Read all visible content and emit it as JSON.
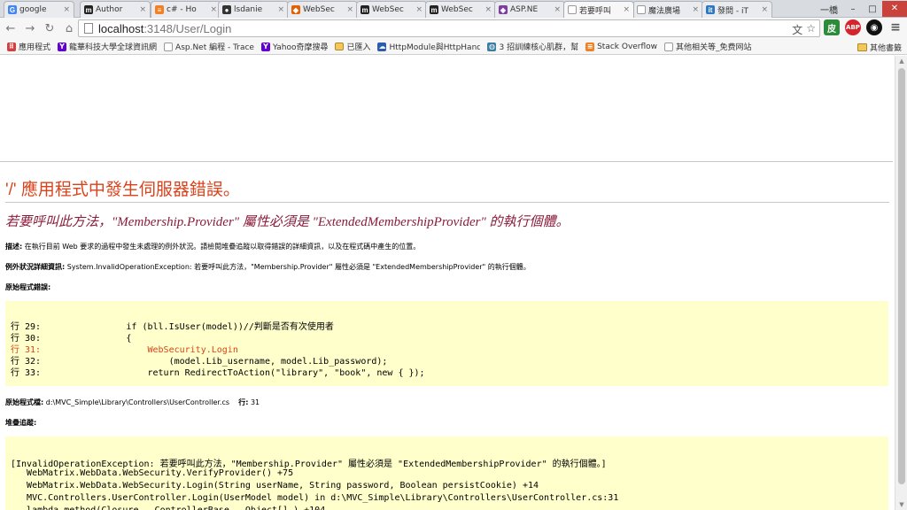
{
  "tabs": [
    {
      "title": "google",
      "icon": "google-icon",
      "color": "#4285f4",
      "glyph": "G"
    },
    {
      "title": "Author",
      "icon": "moodle-icon",
      "color": "#222222",
      "glyph": "m"
    },
    {
      "title": "c# - Ho",
      "icon": "stackoverflow-icon",
      "color": "#f48024",
      "glyph": "≡"
    },
    {
      "title": "lsdanie",
      "icon": "github-icon",
      "color": "#333333",
      "glyph": "●"
    },
    {
      "title": "WebSec",
      "icon": "webfox-icon",
      "color": "#e66000",
      "glyph": "◆"
    },
    {
      "title": "WebSec",
      "icon": "moodle-icon",
      "color": "#222222",
      "glyph": "m"
    },
    {
      "title": "WebSec",
      "icon": "moodle-icon",
      "color": "#222222",
      "glyph": "m"
    },
    {
      "title": "ASP.NE",
      "icon": "aspnet-icon",
      "color": "#7a3ea1",
      "glyph": "◈"
    },
    {
      "title": "若要呼叫",
      "icon": "page-icon",
      "color": "#ffffff",
      "glyph": "",
      "active": true
    },
    {
      "title": "魔法廣場",
      "icon": "page-icon",
      "color": "#ffffff",
      "glyph": ""
    },
    {
      "title": "發問 - iT",
      "icon": "ithome-icon",
      "color": "#2b78c5",
      "glyph": "it"
    }
  ],
  "window": {
    "user": "一橋"
  },
  "toolbar": {
    "url_host": "localhost",
    "url_path": ":3148/User/Login"
  },
  "bookmarks": {
    "items": [
      {
        "label": "應用程式",
        "icon": "apps-grid-icon",
        "color": "#d04040",
        "glyph": "⠿"
      },
      {
        "label": "龍華科技大學全球資訊網",
        "icon": "yahoo-icon",
        "color": "#5f01d1",
        "glyph": "Y"
      },
      {
        "label": "Asp.Net 編程 - Trace",
        "icon": "page-icon",
        "color": "#ffffff",
        "glyph": ""
      },
      {
        "label": "Yahoo奇摩搜尋",
        "icon": "yahoo-icon",
        "color": "#5f01d1",
        "glyph": "Y"
      },
      {
        "label": "已匯入",
        "icon": "folder-icon",
        "color": "#ffffff",
        "glyph": ""
      },
      {
        "label": "HttpModule與HttpHandler",
        "icon": "cloud-icon",
        "color": "#2a5db0",
        "glyph": "☁"
      },
      {
        "label": "3 招訓練核心肌群，幫",
        "icon": "fitness-icon",
        "color": "#3b7ea1",
        "glyph": "◍"
      },
      {
        "label": "Stack Overflow",
        "icon": "stackoverflow-icon",
        "color": "#f48024",
        "glyph": "≡"
      },
      {
        "label": "其他相关等_免费网站",
        "icon": "page-icon",
        "color": "#ffffff",
        "glyph": ""
      }
    ],
    "other": "其他書籤"
  },
  "error": {
    "title_slash": "'/'",
    "title_text": " 應用程式中發生伺服器錯誤。",
    "subtitle": "若要呼叫此方法，\"Membership.Provider\" 屬性必須是 \"ExtendedMembershipProvider\" 的執行個體。",
    "desc_label": "描述:",
    "desc_text": " 在執行目前 Web 要求的過程中發生未處理的例外狀況。請檢閱堆疊追蹤以取得錯誤的詳細資訊，以及在程式碼中產生的位置。",
    "exc_label": "例外狀況詳細資訊:",
    "exc_text": " System.InvalidOperationException: 若要呼叫此方法，\"Membership.Provider\" 屬性必須是 \"ExtendedMembershipProvider\" 的執行個體。",
    "src_label": "原始程式錯誤:",
    "source_lines": [
      {
        "text": "行 29:                if (bll.IsUser(model))//判斷是否有次使用者",
        "hl": false
      },
      {
        "text": "行 30:                {",
        "hl": false
      },
      {
        "text": "行 31:                    WebSecurity.Login",
        "hl": true
      },
      {
        "text": "行 32:                        (model.Lib_username, model.Lib_password);",
        "hl": false
      },
      {
        "text": "行 33:                    return RedirectToAction(\"library\", \"book\", new { });",
        "hl": false
      }
    ],
    "file_label": "原始程式檔:",
    "file_path": " d:\\MVC_Simple\\Library\\Controllers\\UserController.cs",
    "line_label": "行:",
    "line_no": " 31",
    "stack_label": "堆疊追蹤:",
    "stack_lines": [
      "[InvalidOperationException: 若要呼叫此方法，\"Membership.Provider\" 屬性必須是 \"ExtendedMembershipProvider\" 的執行個體。]",
      "   WebMatrix.WebData.WebSecurity.VerifyProvider() +75",
      "   WebMatrix.WebData.WebSecurity.Login(String userName, String password, Boolean persistCookie) +14",
      "   MVC.Controllers.UserController.Login(UserModel model) in d:\\MVC_Simple\\Library\\Controllers\\UserController.cs:31",
      "   lambda_method(Closure , ControllerBase , Object[] ) +104"
    ]
  }
}
